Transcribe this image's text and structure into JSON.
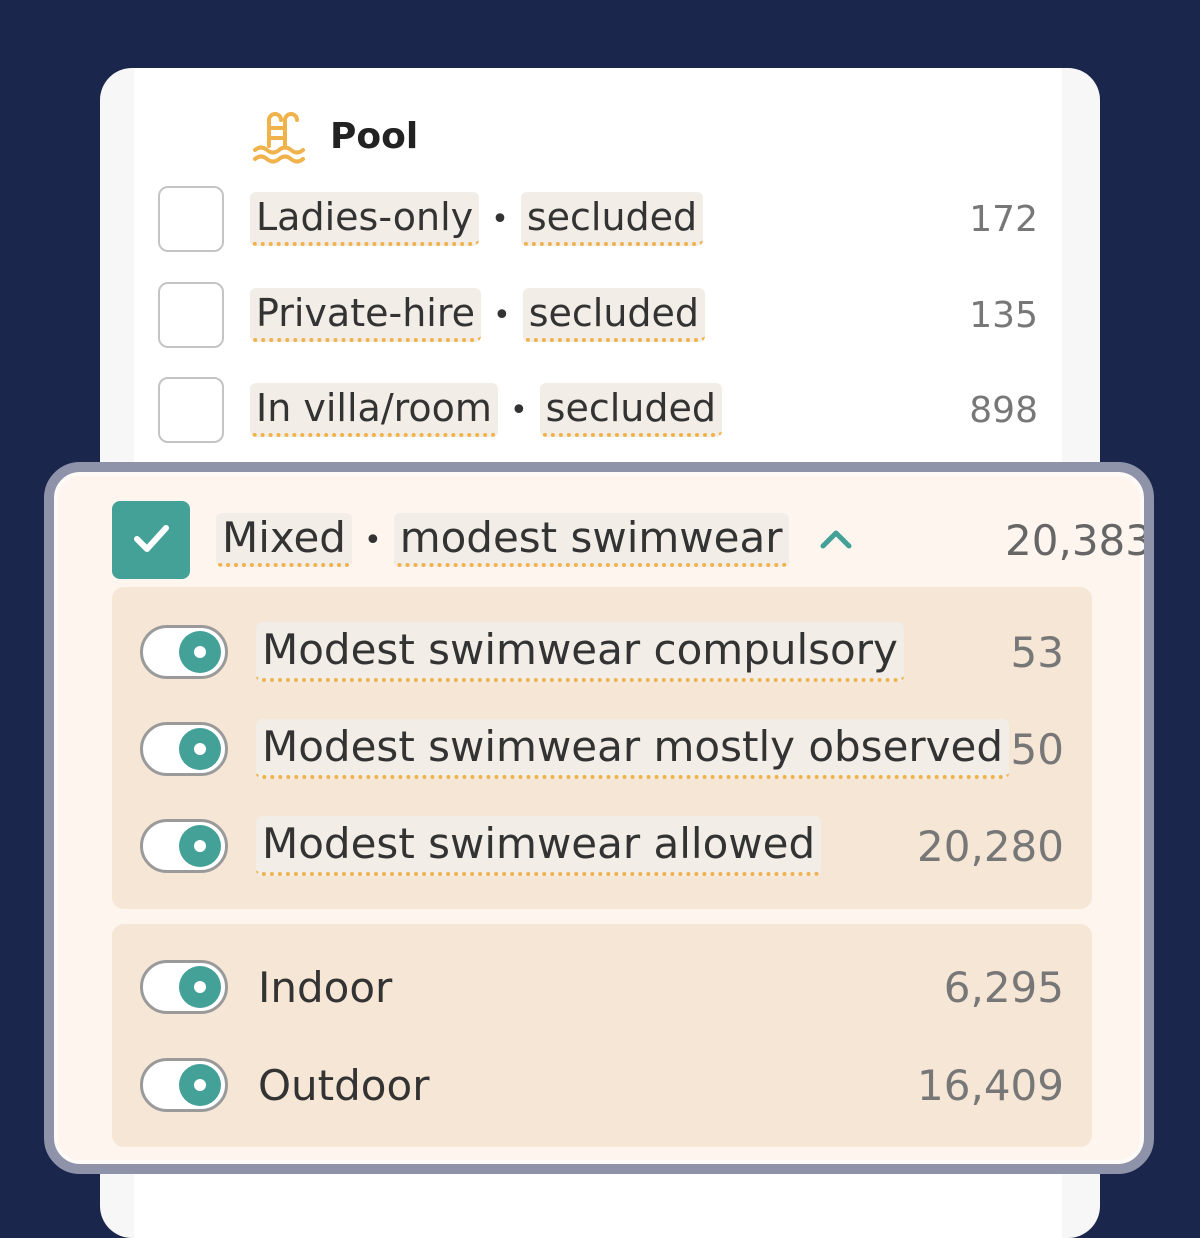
{
  "pool": {
    "icon": "pool-ladder-icon",
    "title": "Pool"
  },
  "options": [
    {
      "tag1": "Ladies-only",
      "tag2": "secluded",
      "count": "172"
    },
    {
      "tag1": "Private-hire",
      "tag2": "secluded",
      "count": "135"
    },
    {
      "tag1": "In villa/room",
      "tag2": "secluded",
      "count": "898"
    }
  ],
  "separator": "•",
  "mixed": {
    "tag1": "Mixed",
    "tag2": "modest swimwear",
    "count": "20,383",
    "checked": true,
    "expanded": true
  },
  "modesty": [
    {
      "label": "Modest swimwear compulsory",
      "count": "53",
      "on": true
    },
    {
      "label": "Modest swimwear mostly observed",
      "count": "50",
      "on": true
    },
    {
      "label": "Modest swimwear allowed",
      "count": "20,280",
      "on": true
    }
  ],
  "location": [
    {
      "label": "Indoor",
      "count": "6,295",
      "on": true
    },
    {
      "label": "Outdoor",
      "count": "16,409",
      "on": true
    }
  ],
  "colors": {
    "background": "#1a264b",
    "accent": "#43a197",
    "underline": "#f0b24a",
    "highlight_bg": "#fdf5ee",
    "subgroup_bg": "#f5e6d6"
  }
}
